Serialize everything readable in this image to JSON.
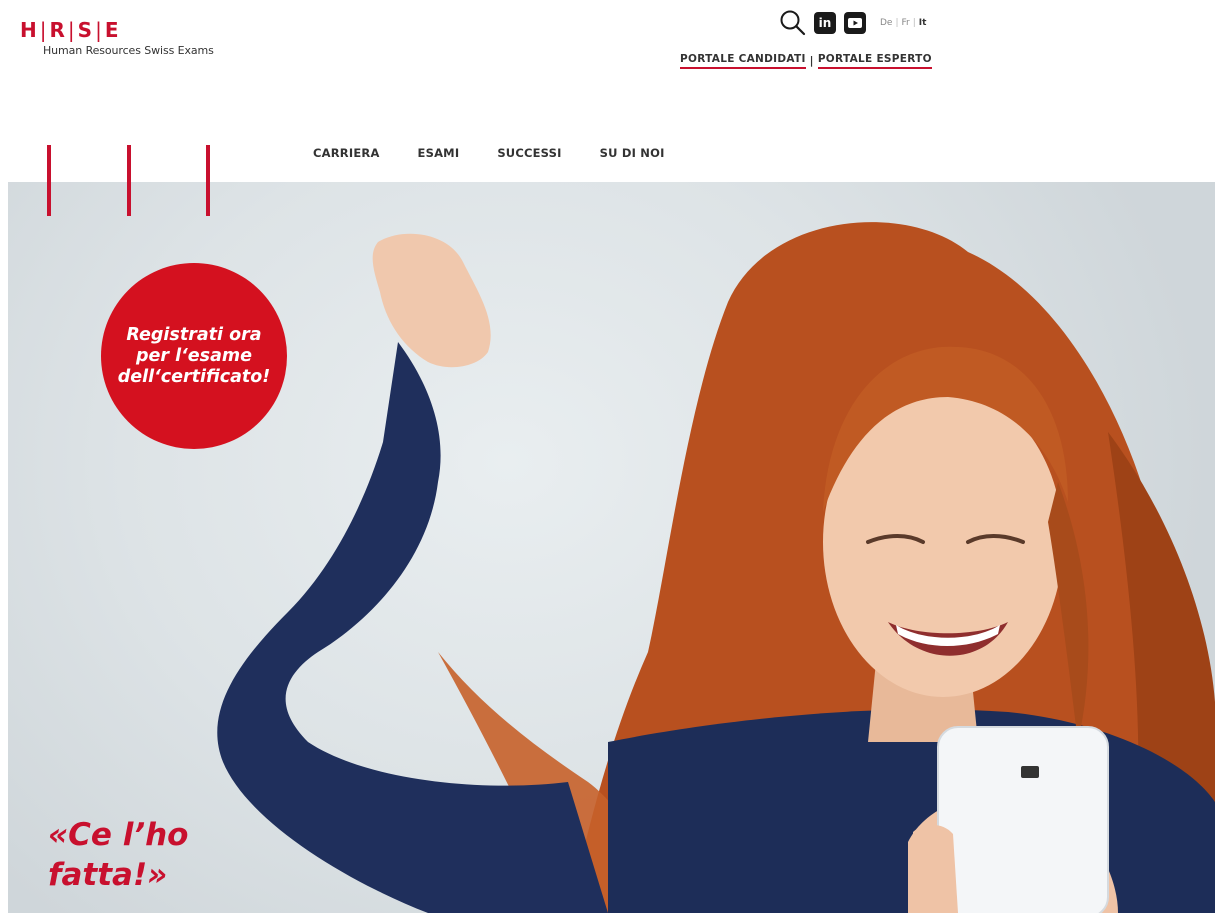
{
  "brand": {
    "letters": [
      "H",
      "R",
      "S",
      "E"
    ],
    "separator": "|",
    "subtitle": "Human Resources Swiss Exams",
    "accent_color": "#c8102e"
  },
  "header": {
    "icons": [
      "search-icon",
      "linkedin-icon",
      "youtube-icon"
    ],
    "linkedin_glyph": "in",
    "youtube_glyph": "▶",
    "languages": [
      {
        "label": "De",
        "active": false
      },
      {
        "label": "Fr",
        "active": false
      },
      {
        "label": "It",
        "active": true
      }
    ],
    "portals": [
      {
        "label": "PORTALE CANDIDATI"
      },
      {
        "label": "PORTALE ESPERTO"
      }
    ],
    "portal_separator": "|"
  },
  "nav": {
    "items": [
      "CARRIERA",
      "ESAMI",
      "SUCCESSI",
      "SU DI NOI"
    ]
  },
  "hero": {
    "cta_text": "Registrati ora per l‘esame dell‘certificato!",
    "quote": "«Ce l’ho fatta!»",
    "cta_color": "#d4111f"
  }
}
